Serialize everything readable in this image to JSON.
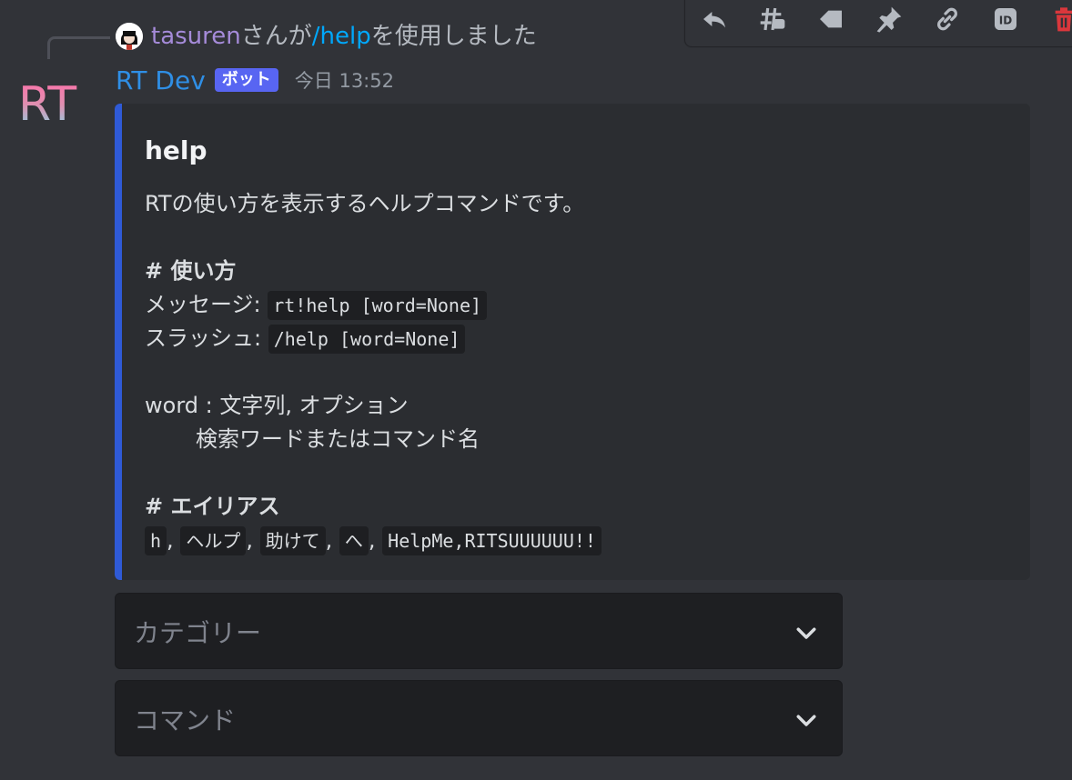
{
  "toolbar": {
    "icons": [
      "reply-icon",
      "thread-icon",
      "tag-icon",
      "pin-icon",
      "link-icon",
      "id-icon",
      "delete-icon"
    ],
    "id_label": "ID"
  },
  "reference": {
    "user": "tasuren",
    "text1": "さんが",
    "command": "/help",
    "text2": "を使用しました"
  },
  "message": {
    "author": "RT Dev",
    "bot_tag": "ボット",
    "timestamp": "今日 13:52",
    "avatar_text": "RT"
  },
  "embed": {
    "accent_color": "#2f5ad6",
    "title": "help",
    "description": "RTの使い方を表示するヘルプコマンドです。",
    "usage_heading": "# 使い方",
    "message_label": "メッセージ:",
    "message_code": "rt!help [word=None]",
    "slash_label": "スラッシュ:",
    "slash_code": "/help [word=None]",
    "word_line": "word : 文字列, オプション",
    "word_desc": "検索ワードまたはコマンド名",
    "alias_heading": "# エイリアス",
    "aliases": [
      "h",
      "ヘルプ",
      "助けて",
      "へ",
      "HelpMe,RITSUUUUUU!!"
    ],
    "alias_sep": ","
  },
  "selects": [
    {
      "placeholder": "カテゴリー"
    },
    {
      "placeholder": "コマンド"
    }
  ]
}
